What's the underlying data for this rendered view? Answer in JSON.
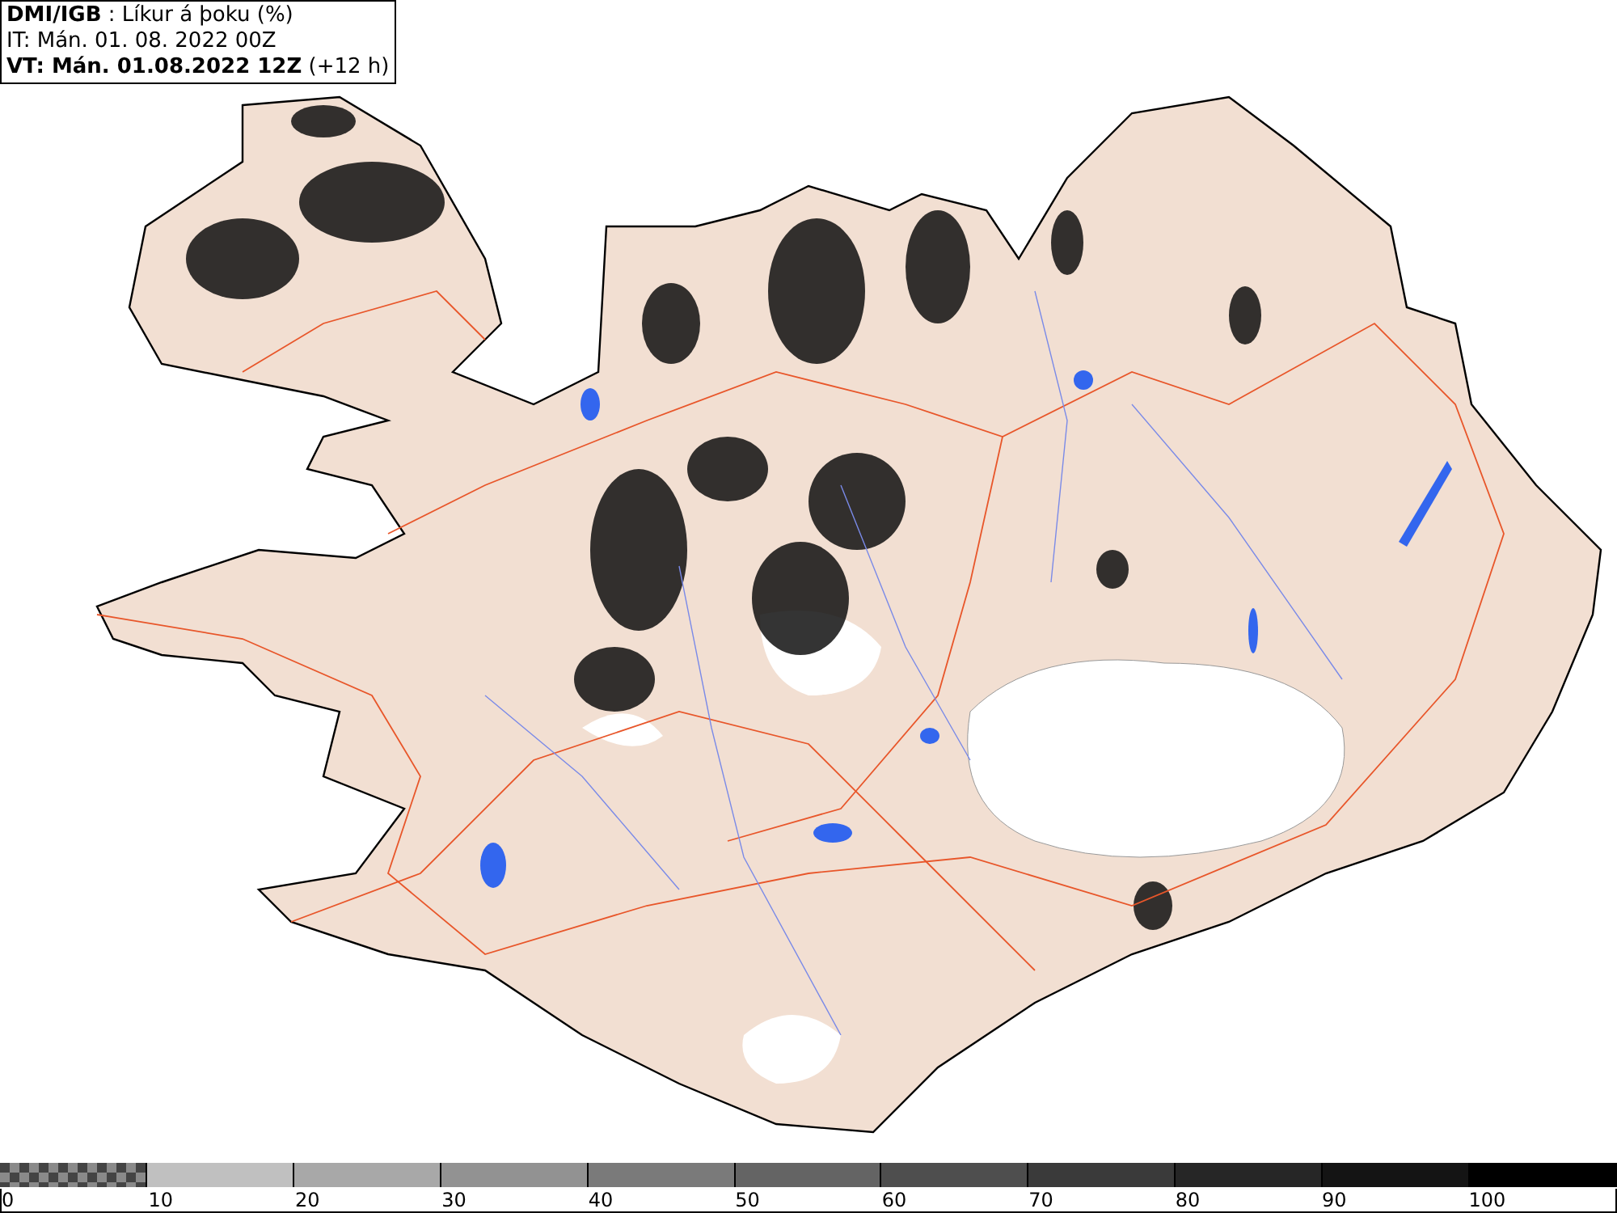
{
  "header": {
    "title": "**DMI/IGB** : Líkur á þoku (%)",
    "issue_time": "IT: Mán. 01. 08. 2022 00Z",
    "valid_time": "**VT: Mán. 01.08.2022 12Z** (+12 h)"
  },
  "legend": {
    "segments": [
      {
        "kind": "checker",
        "color": "#8a8a8a"
      },
      {
        "kind": "solid",
        "color": "#c0c0c0"
      },
      {
        "kind": "solid",
        "color": "#a8a8a8"
      },
      {
        "kind": "solid",
        "color": "#929292"
      },
      {
        "kind": "solid",
        "color": "#7a7a7a"
      },
      {
        "kind": "solid",
        "color": "#646464"
      },
      {
        "kind": "solid",
        "color": "#4e4e4e"
      },
      {
        "kind": "solid",
        "color": "#3a3a3a"
      },
      {
        "kind": "solid",
        "color": "#262626"
      },
      {
        "kind": "solid",
        "color": "#141414"
      },
      {
        "kind": "solid",
        "color": "#000000"
      }
    ],
    "tick_labels": [
      "0",
      "10",
      "20",
      "30",
      "40",
      "50",
      "60",
      "70",
      "80",
      "90",
      "100"
    ]
  }
}
